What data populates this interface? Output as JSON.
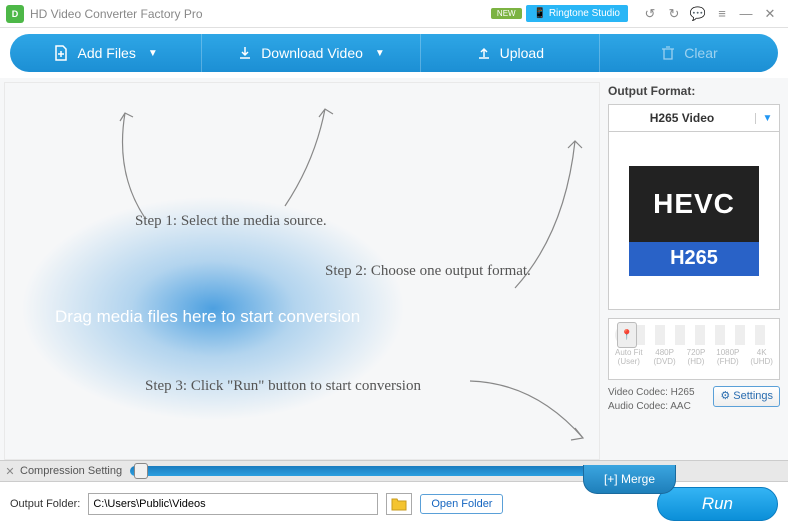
{
  "titlebar": {
    "logo_text": "D",
    "title": "HD Video Converter Factory Pro",
    "new_badge": "NEW",
    "ringtone": "Ringtone Studio"
  },
  "toolbar": {
    "add_files": "Add Files",
    "download_video": "Download Video",
    "upload": "Upload",
    "clear": "Clear"
  },
  "canvas": {
    "step1": "Step 1: Select the media source.",
    "step2": "Step 2: Choose one output format.",
    "step3": "Step 3: Click \"Run\" button to start conversion",
    "drag_text": "Drag media files here to start conversion"
  },
  "side": {
    "label": "Output Format:",
    "format_value": "H265 Video",
    "hevc_top": "HEVC",
    "hevc_bot": "H265",
    "quality": [
      {
        "a": "Auto Fit",
        "b": "(User)"
      },
      {
        "a": "480P",
        "b": "(DVD)"
      },
      {
        "a": "720P",
        "b": "(HD)"
      },
      {
        "a": "1080P",
        "b": "(FHD)"
      },
      {
        "a": "4K",
        "b": "(UHD)"
      }
    ],
    "video_codec": "Video Codec: H265",
    "audio_codec": "Audio Codec: AAC",
    "settings": "Settings"
  },
  "compress": {
    "label": "Compression Setting"
  },
  "merge": {
    "label": "[+] Merge"
  },
  "footer": {
    "label": "Output Folder:",
    "path": "C:\\Users\\Public\\Videos",
    "open_folder": "Open Folder",
    "run": "Run"
  }
}
